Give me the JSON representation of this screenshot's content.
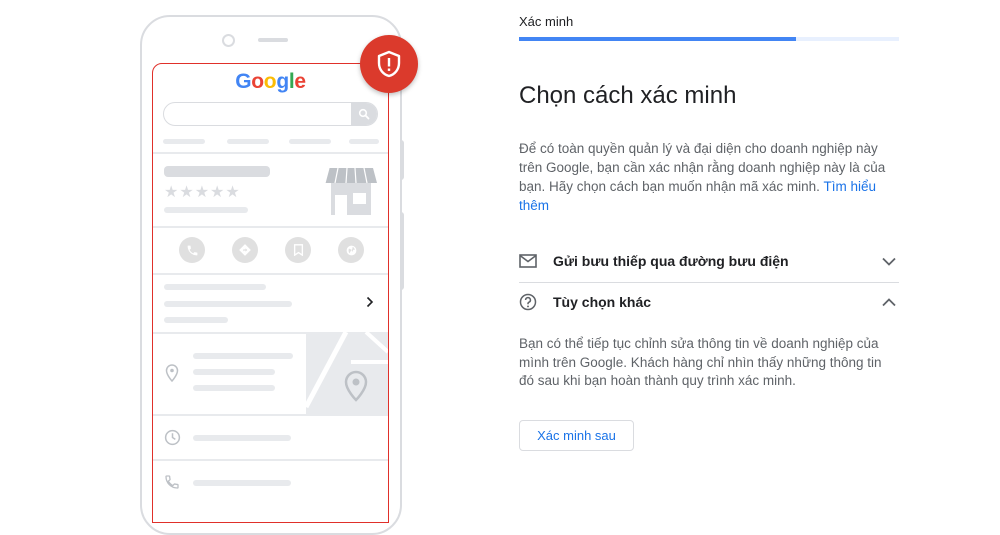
{
  "illustration": {
    "logo_text": "Google",
    "rating_stars": "★★★★★"
  },
  "progress": {
    "step_label": "Xác minh",
    "fraction": 0.73
  },
  "page": {
    "title": "Chọn cách xác minh",
    "description": "Để có toàn quyền quản lý và đại diện cho doanh nghiệp này trên Google, bạn cần xác nhận rằng doanh nghiệp này là của bạn. Hãy chọn cách bạn muốn nhận mã xác minh.",
    "learn_more": "Tìm hiểu thêm"
  },
  "options": [
    {
      "label": "Gửi bưu thiếp qua đường bưu điện",
      "icon": "mail-icon",
      "expanded": false
    },
    {
      "label": "Tùy chọn khác",
      "icon": "help-circle-icon",
      "expanded": true
    }
  ],
  "other_options": {
    "description": "Bạn có thể tiếp tục chỉnh sửa thông tin về doanh nghiệp của mình trên Google. Khách hàng chỉ nhìn thấy những thông tin đó sau khi bạn hoàn thành quy trình xác minh.",
    "button_label": "Xác minh sau"
  },
  "colors": {
    "accent": "#1a73e8",
    "progress": "#4285f4",
    "badge": "#db3a2c",
    "phone_outline": "#e0302a"
  }
}
